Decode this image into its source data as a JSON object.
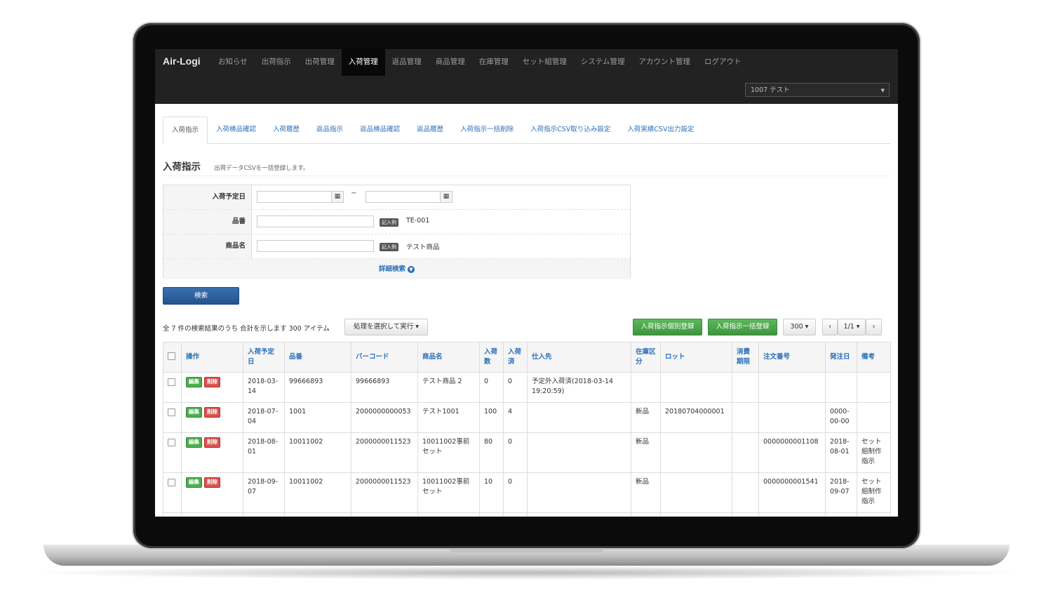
{
  "app": {
    "brand": "Air-Logi",
    "nav": [
      {
        "label": "お知らせ",
        "active": false
      },
      {
        "label": "出荷指示",
        "active": false
      },
      {
        "label": "出荷管理",
        "active": false
      },
      {
        "label": "入荷管理",
        "active": true
      },
      {
        "label": "返品管理",
        "active": false
      },
      {
        "label": "商品管理",
        "active": false
      },
      {
        "label": "在庫管理",
        "active": false
      },
      {
        "label": "セット組管理",
        "active": false
      },
      {
        "label": "システム管理",
        "active": false
      },
      {
        "label": "アカウント管理",
        "active": false
      },
      {
        "label": "ログアウト",
        "active": false
      }
    ],
    "account_select": "1007 テスト"
  },
  "tabs": [
    "入荷指示",
    "入荷検品確認",
    "入荷履歴",
    "返品指示",
    "返品検品確認",
    "返品履歴",
    "入荷指示一括削除",
    "入荷指示CSV取り込み設定",
    "入荷実績CSV出力設定"
  ],
  "page": {
    "title": "入荷指示",
    "subtitle": "出荷データCSVを一括登録します。"
  },
  "form": {
    "date_label": "入荷予定日",
    "tilde": "~",
    "sku_label": "品番",
    "name_label": "商品名",
    "example_badge": "記入例",
    "sku_example": "TE-001",
    "name_example": "テスト商品",
    "advanced_search": "詳細検索",
    "search_button": "検索",
    "calendar_icon": "calendar-icon",
    "chevron_icon": "chevron-down-icon"
  },
  "toolbar": {
    "summary": "全 7 件の検索結果のうち 合計を示します 300 アイテム",
    "bulk_action": "処理を選択して実行 ▾",
    "register_individual": "入荷指示個別登録",
    "register_bulk": "入荷指示一括登録",
    "per_page": "300 ▾",
    "prev": "‹",
    "page": "1/1 ▾",
    "next": "›"
  },
  "table": {
    "headers": [
      "操作",
      "入荷予定日",
      "品番",
      "バーコード",
      "商品名",
      "入荷数",
      "入荷済",
      "仕入先",
      "在庫区分",
      "ロット",
      "消費期限",
      "注文番号",
      "発注日",
      "備考"
    ],
    "edit_label": "編集",
    "delete_label": "削除",
    "rows": [
      [
        "2018-03-14",
        "99666893",
        "99666893",
        "テスト商品 2",
        "0",
        "0",
        "予定外入荷済(2018-03-14 19:20:59)",
        "",
        "",
        "",
        "",
        "",
        ""
      ],
      [
        "2018-07-04",
        "1001",
        "2000000000053",
        "テスト1001",
        "100",
        "4",
        "",
        "新品",
        "20180704000001",
        "",
        "",
        "0000-00-00",
        ""
      ],
      [
        "2018-08-01",
        "10011002",
        "2000000011523",
        "10011002事前セット",
        "80",
        "0",
        "",
        "新品",
        "",
        "",
        "0000000001108",
        "2018-08-01",
        "セット組制作指示"
      ],
      [
        "2018-09-07",
        "10011002",
        "2000000011523",
        "10011002事前セット",
        "10",
        "0",
        "",
        "新品",
        "",
        "",
        "0000000001541",
        "2018-09-07",
        "セット組制作指示"
      ]
    ]
  },
  "colors": {
    "navbar": "#222222",
    "link": "#2a6fba",
    "primary_button": "#2c5f9e",
    "success": "#4cae4c",
    "danger": "#d9534f"
  }
}
